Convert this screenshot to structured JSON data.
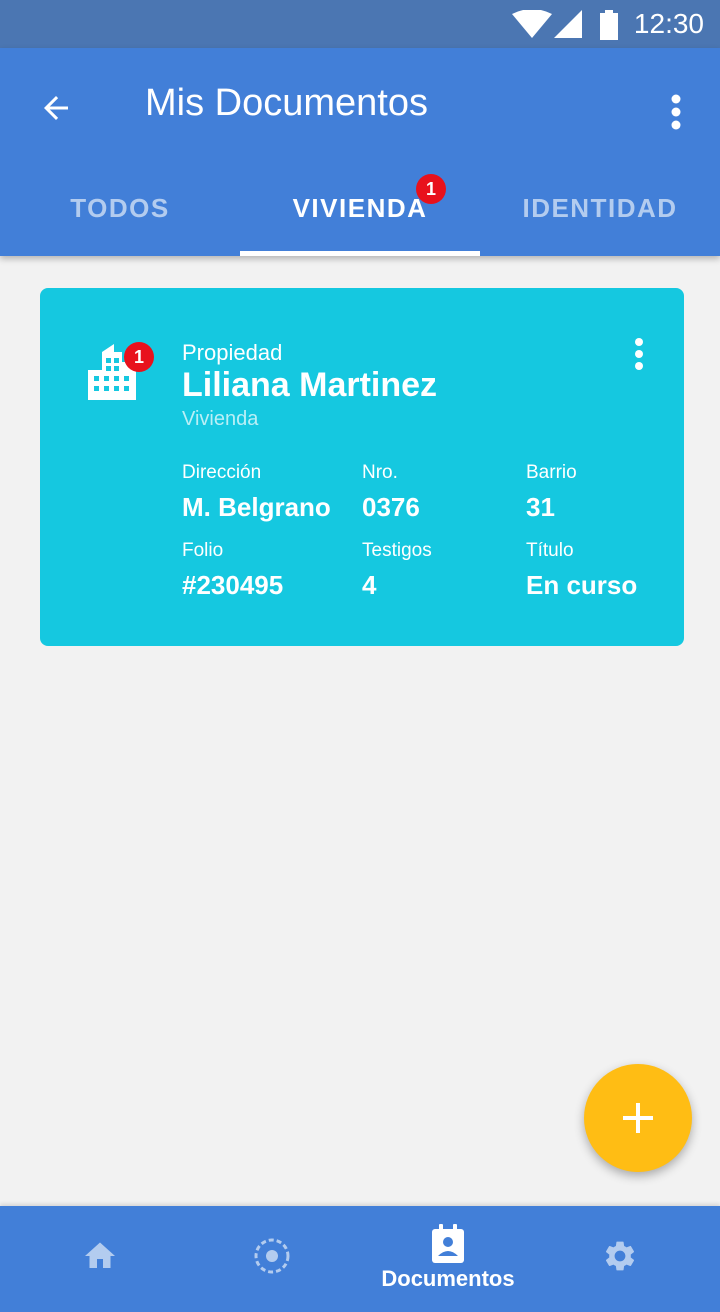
{
  "status_bar": {
    "time": "12:30",
    "icons": [
      "wifi-icon",
      "signal-icon",
      "battery-icon"
    ]
  },
  "header": {
    "title": "Mis Documentos",
    "back_icon": "arrow-back-icon",
    "menu_icon": "more-vert-icon"
  },
  "tabs": [
    {
      "label": "TODOS",
      "active": false
    },
    {
      "label": "VIVIENDA",
      "active": true,
      "badge": "1"
    },
    {
      "label": "IDENTIDAD",
      "active": false
    }
  ],
  "card": {
    "icon": "building-icon",
    "badge": "1",
    "category": "Propiedad",
    "name": "Liliana Martinez",
    "type": "Vivienda",
    "fields": [
      {
        "label": "Dirección",
        "value": "M. Belgrano"
      },
      {
        "label": "Nro.",
        "value": "0376"
      },
      {
        "label": "Barrio",
        "value": "31"
      },
      {
        "label": "Folio",
        "value": "#230495"
      },
      {
        "label": "Testigos",
        "value": "4"
      },
      {
        "label": "Título",
        "value": "En curso"
      }
    ],
    "color": "#15c8e0"
  },
  "fab": {
    "icon": "plus-icon",
    "color": "#ffbd14"
  },
  "bottom_nav": [
    {
      "icon": "home-icon",
      "label": "",
      "active": false
    },
    {
      "icon": "target-icon",
      "label": "",
      "active": false
    },
    {
      "icon": "assignment-ind-icon",
      "label": "Documentos",
      "active": true
    },
    {
      "icon": "settings-icon",
      "label": "",
      "active": false
    }
  ],
  "colors": {
    "primary": "#427fd8",
    "status_bar": "#4b76b2",
    "badge": "#e8111c",
    "background": "#f2f2f2"
  }
}
